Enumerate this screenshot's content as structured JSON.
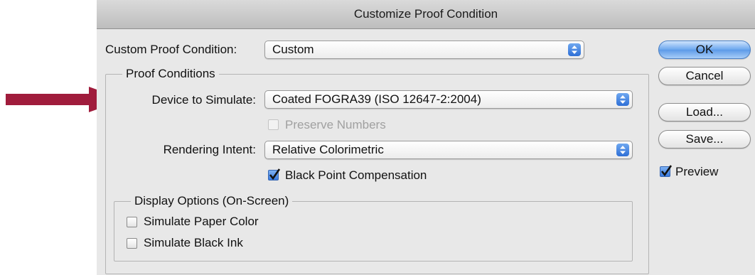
{
  "window": {
    "title": "Customize Proof Condition"
  },
  "custom_proof": {
    "label": "Custom Proof Condition:",
    "value": "Custom"
  },
  "proof_conditions": {
    "legend": "Proof Conditions",
    "device_label": "Device to Simulate:",
    "device_value": "Coated FOGRA39 (ISO 12647-2:2004)",
    "preserve_numbers": {
      "label": "Preserve Numbers",
      "checked": false,
      "enabled": false
    },
    "intent_label": "Rendering Intent:",
    "intent_value": "Relative Colorimetric",
    "black_point": {
      "label": "Black Point Compensation",
      "checked": true
    }
  },
  "display_options": {
    "legend": "Display Options (On-Screen)",
    "paper_color": {
      "label": "Simulate Paper Color",
      "checked": false
    },
    "black_ink": {
      "label": "Simulate Black Ink",
      "checked": false
    }
  },
  "buttons": {
    "ok": "OK",
    "cancel": "Cancel",
    "load": "Load...",
    "save": "Save..."
  },
  "preview": {
    "label": "Preview",
    "checked": true
  },
  "annotation": {
    "arrow_color": "#a01c3c"
  },
  "colors": {
    "accent": "#3a7be0",
    "dialog_bg": "#e8e8e8"
  }
}
